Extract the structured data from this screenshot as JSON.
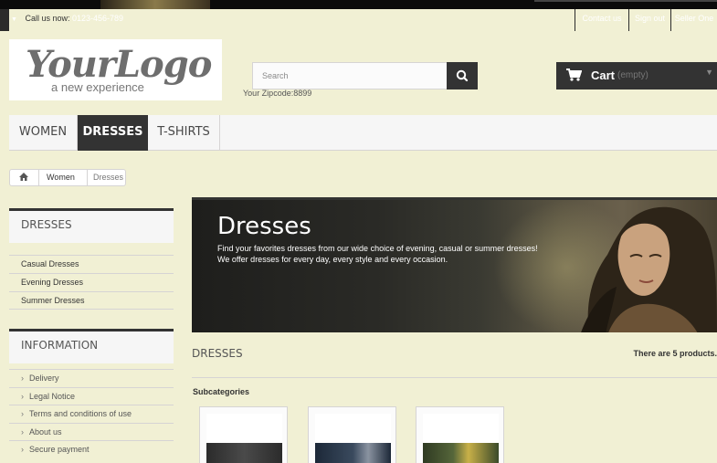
{
  "topbar": {
    "call_label": "Call us now:",
    "phone": "0123-456-789",
    "links": [
      "Contact us",
      "Sign out",
      "Seller One"
    ]
  },
  "header": {
    "logo_main": "YourLogo",
    "logo_sub": "a new experience",
    "search_placeholder": "Search",
    "zipcode": "Your Zipcode:8899",
    "cart_label": "Cart",
    "cart_status": "(empty)"
  },
  "menu": {
    "items": [
      "WOMEN",
      "DRESSES",
      "T-SHIRTS"
    ],
    "active": "DRESSES"
  },
  "breadcrumb": {
    "items": [
      "Women",
      "Dresses"
    ]
  },
  "sidebar": {
    "categories_title": "DRESSES",
    "categories": [
      "Casual Dresses",
      "Evening Dresses",
      "Summer Dresses"
    ],
    "information_title": "INFORMATION",
    "information": [
      "Delivery",
      "Legal Notice",
      "Terms and conditions of use",
      "About us",
      "Secure payment"
    ]
  },
  "category": {
    "title": "Dresses",
    "description_line1": "Find your favorites dresses from our wide choice of evening, casual or summer dresses!",
    "description_line2": "We offer dresses for every day, every style and every occasion.",
    "heading": "DRESSES",
    "product_count": "There are 5 products.",
    "subcategories_title": "Subcategories"
  },
  "colors": {
    "dark": "#333333",
    "background": "#f1f0d4",
    "border": "#d6d4d4"
  }
}
